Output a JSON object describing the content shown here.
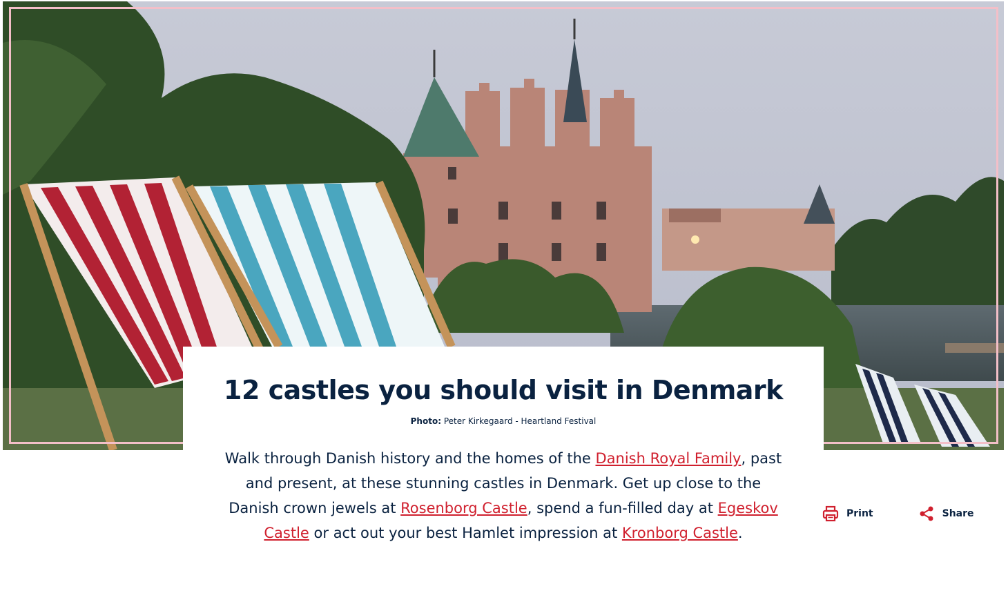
{
  "hero": {
    "alt_description_icon": "castle-photo",
    "frame_color": "#f3bfc8"
  },
  "article": {
    "title": "12 castles you should visit in Denmark",
    "credit_label": "Photo:",
    "credit_text": "Peter Kirkegaard - Heartland Festival",
    "intro": {
      "p1": "Walk through Danish history and the homes of the ",
      "link1": "Danish Royal Family",
      "p2": ", past and present, at these stunning castles in Denmark. Get up close to the Danish crown jewels at ",
      "link2": "Rosenborg Castle",
      "p3": ", spend a fun-filled day at ",
      "link3": "Egeskov Castle",
      "p4": " or act out your best Hamlet impression at ",
      "link4": "Kronborg Castle",
      "p5": "."
    }
  },
  "actions": {
    "print_label": "Print",
    "print_icon": "printer-icon",
    "share_label": "Share",
    "share_icon": "share-icon",
    "accent_color": "#d0202e"
  },
  "colors": {
    "text": "#0a2240",
    "link": "#d0202e"
  }
}
